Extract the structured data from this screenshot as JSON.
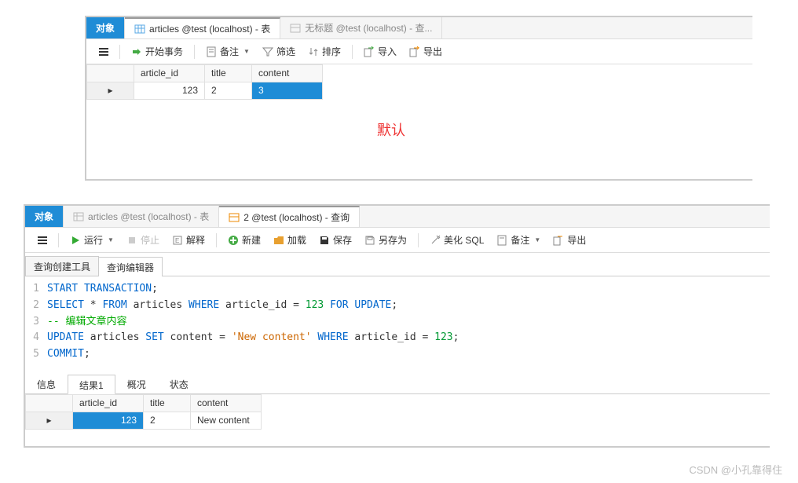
{
  "panel1": {
    "tabs": {
      "obj": "对象",
      "articles": "articles @test (localhost) - 表",
      "untitled": "无标题 @test (localhost) - 查..."
    },
    "toolbar": {
      "begin": "开始事务",
      "memo": "备注",
      "filter": "筛选",
      "sort": "排序",
      "import": "导入",
      "export": "导出"
    },
    "headers": [
      "article_id",
      "title",
      "content"
    ],
    "row": {
      "article_id": "123",
      "title": "2",
      "content": "3"
    },
    "note": "默认"
  },
  "panel2": {
    "tabs": {
      "obj": "对象",
      "articles": "articles @test (localhost) - 表",
      "query": "2 @test (localhost) - 查询"
    },
    "toolbar": {
      "run": "运行",
      "stop": "停止",
      "explain": "解释",
      "new": "新建",
      "load": "加载",
      "save": "保存",
      "saveas": "另存为",
      "beautify": "美化 SQL",
      "memo": "备注",
      "export": "导出"
    },
    "subtabs": {
      "builder": "查询创建工具",
      "editor": "查询编辑器"
    },
    "sql": {
      "l1": {
        "a": "START TRANSACTION",
        "b": ";"
      },
      "l2": {
        "a": "SELECT",
        "b": " * ",
        "c": "FROM",
        "d": " articles ",
        "e": "WHERE",
        "f": " article_id = ",
        "g": "123",
        "h": " FOR UPDATE",
        "i": ";"
      },
      "l3": "-- 编辑文章内容",
      "l4": {
        "a": "UPDATE",
        "b": " articles ",
        "c": "SET",
        "d": " content = ",
        "e": "'New content'",
        "f": " WHERE",
        "g": " article_id = ",
        "h": "123",
        "i": ";"
      },
      "l5": {
        "a": "COMMIT",
        "b": ";"
      }
    },
    "rtabs": {
      "info": "信息",
      "result": "结果1",
      "profile": "概况",
      "status": "状态"
    },
    "headers": [
      "article_id",
      "title",
      "content"
    ],
    "row": {
      "article_id": "123",
      "title": "2",
      "content": "New content"
    }
  },
  "watermark": "CSDN @小孔靠得住"
}
